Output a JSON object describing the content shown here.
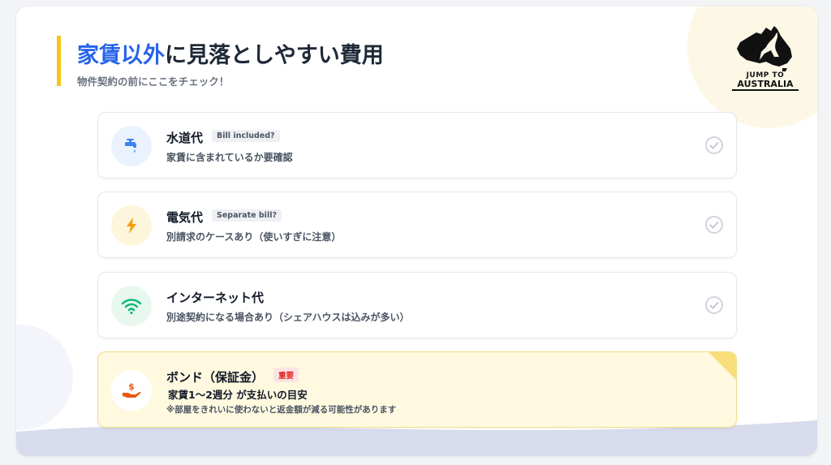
{
  "header": {
    "title_highlight": "家賃以外",
    "title_rest": "に見落としやすい費用",
    "subtitle": "物件契約の前にここをチェック！"
  },
  "logo": {
    "line1": "JUMP TO",
    "line2": "AUSTRALIA"
  },
  "colors": {
    "accent": "#f5c518",
    "highlight": "#2563eb",
    "important": "#dc2626"
  },
  "items": [
    {
      "title": "水道代",
      "badge": "Bill included?",
      "desc": "家賃に含まれているか要確認",
      "icon": "water-faucet-icon"
    },
    {
      "title": "電気代",
      "badge": "Separate bill?",
      "desc": "別請求のケースあり（使いすぎに注意）",
      "icon": "lightning-icon"
    },
    {
      "title": "インターネット代",
      "desc": "別途契約になる場合あり（シェアハウスは込みが多い）",
      "icon": "wifi-icon"
    }
  ],
  "bond": {
    "title": "ボンド（保証金）",
    "badge": "重要",
    "desc_main": "家賃1〜2週分 が支払いの目安",
    "desc_note": "※部屋をきれいに使わないと返金額が減る可能性があります",
    "icon": "money-hand-icon"
  }
}
